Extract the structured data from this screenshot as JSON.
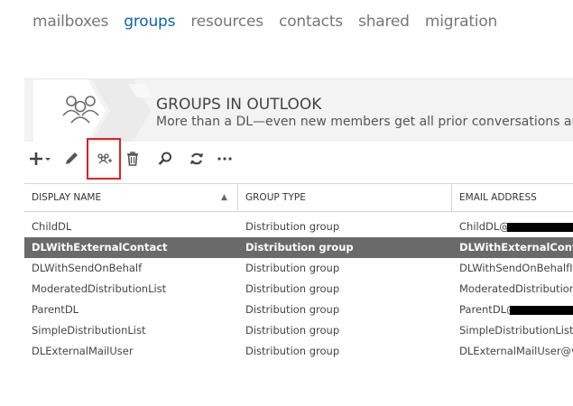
{
  "tabs": [
    {
      "label": "mailboxes",
      "active": false
    },
    {
      "label": "groups",
      "active": true
    },
    {
      "label": "resources",
      "active": false
    },
    {
      "label": "contacts",
      "active": false
    },
    {
      "label": "shared",
      "active": false
    },
    {
      "label": "migration",
      "active": false
    }
  ],
  "banner": {
    "title": "GROUPS IN OUTLOOK",
    "subtitle": "More than a DL—even new members get all prior conversations and att",
    "icon": "group-people-icon"
  },
  "toolbar": {
    "buttons": [
      {
        "name": "add-button",
        "icon": "plus-dropdown-icon"
      },
      {
        "name": "edit-button",
        "icon": "pencil-icon"
      },
      {
        "name": "upgrade-group-button",
        "icon": "group-upgrade-icon",
        "highlighted": true
      },
      {
        "name": "delete-button",
        "icon": "trash-icon"
      },
      {
        "name": "search-button",
        "icon": "search-icon"
      },
      {
        "name": "refresh-button",
        "icon": "refresh-icon"
      },
      {
        "name": "more-button",
        "icon": "ellipsis-icon"
      }
    ],
    "highlight_color": "#e02020"
  },
  "table": {
    "columns": [
      "DISPLAY NAME",
      "GROUP TYPE",
      "EMAIL ADDRESS"
    ],
    "sort_indicator": "▲",
    "rows": [
      {
        "name": "ChildDL",
        "type": "Distribution group",
        "email": "ChildDL@v",
        "selected": false,
        "redacted": true
      },
      {
        "name": "DLWithExternalContact",
        "type": "Distribution group",
        "email": "DLWithExternalContact",
        "selected": true,
        "redacted": false
      },
      {
        "name": "DLWithSendOnBehalf",
        "type": "Distribution group",
        "email": "DLWithSendOnBehalfIf@",
        "selected": false,
        "redacted": false
      },
      {
        "name": "ModeratedDistributionList",
        "type": "Distribution group",
        "email": "ModeratedDistributionL",
        "selected": false,
        "redacted": false
      },
      {
        "name": "ParentDL",
        "type": "Distribution group",
        "email": "ParentDL@",
        "selected": false,
        "redacted": true
      },
      {
        "name": "SimpleDistributionList",
        "type": "Distribution group",
        "email": "SimpleDistributionList@",
        "selected": false,
        "redacted": false
      },
      {
        "name": "DLExternalMailUser",
        "type": "Distribution group",
        "email": "DLExternalMailUser@vip",
        "selected": false,
        "redacted": false
      }
    ]
  },
  "colors": {
    "accent": "#0a64b4",
    "selected_row": "#6a6a6a",
    "tab_inactive": "#777777"
  }
}
